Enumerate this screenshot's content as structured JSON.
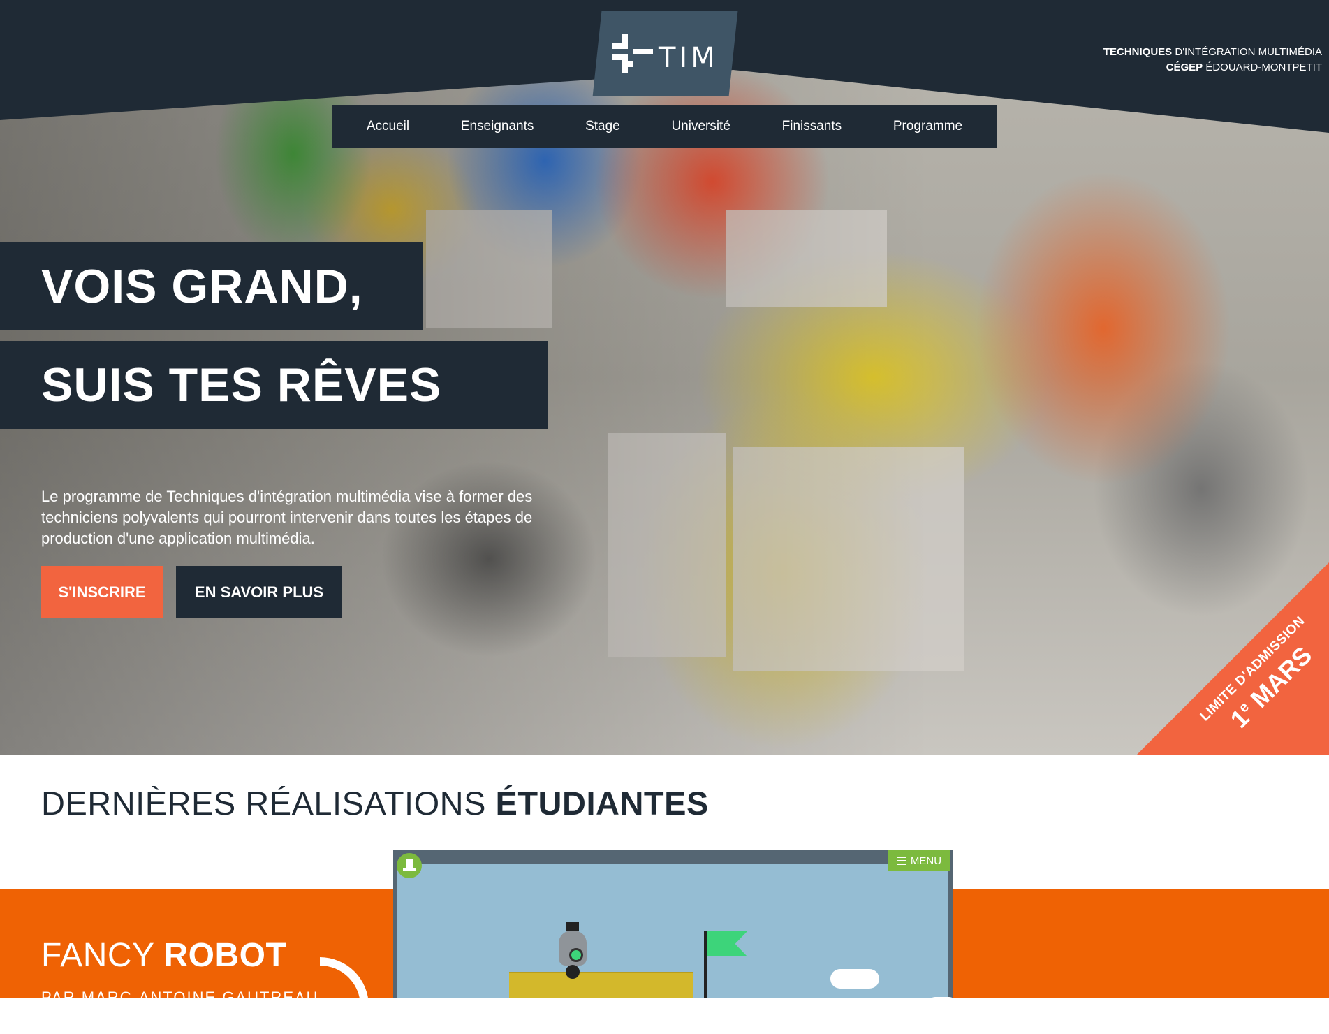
{
  "header": {
    "logo_text": "TIM",
    "brand_line1_bold": "TECHNIQUES",
    "brand_line1_rest": " D'INTÉGRATION MULTIMÉDIA",
    "brand_line2_bold": "CÉGEP",
    "brand_line2_rest": " ÉDOUARD-MONTPETIT"
  },
  "nav": {
    "items": [
      {
        "label": "Accueil"
      },
      {
        "label": "Enseignants"
      },
      {
        "label": "Stage"
      },
      {
        "label": "Université"
      },
      {
        "label": "Finissants"
      },
      {
        "label": "Programme"
      }
    ]
  },
  "hero": {
    "headline_1": "VOIS GRAND,",
    "headline_2": "SUIS TES RÊVES",
    "lead": "Le programme de Techniques d'intégration multimédia vise à former des techniciens polyvalents qui pourront intervenir dans toutes les étapes de production d'une application multimédia.",
    "signup_label": "S'INSCRIRE",
    "more_label": "EN SAVOIR PLUS",
    "ribbon_line1": "LIMITE D'ADMISSION",
    "ribbon_day": "1",
    "ribbon_sup": "e",
    "ribbon_month": " MARS"
  },
  "section": {
    "title_light": "DERNIÈRES RÉALISATIONS ",
    "title_bold": "ÉTUDIANTES"
  },
  "project": {
    "title_light": "FANCY ",
    "title_bold": "ROBOT",
    "author": "PAR MARC-ANTOINE GAUTREAU",
    "game_menu_label": "MENU"
  },
  "colors": {
    "dark": "#1f2a35",
    "accent_coral": "#f2643f",
    "orange_band": "#ef6204",
    "game_green": "#7cba3e"
  },
  "icons": {
    "logo": "plus-cross-logo-icon",
    "menu": "hamburger-icon",
    "game_badge": "hat-icon",
    "next": "chevron-right-icon"
  }
}
